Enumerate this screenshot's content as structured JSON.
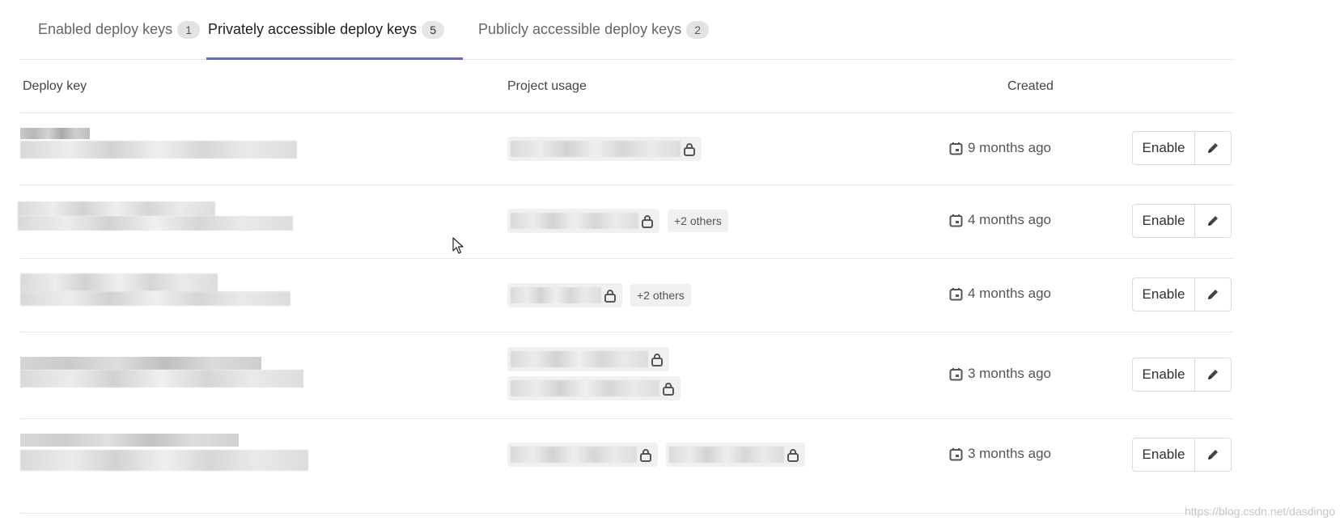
{
  "tabs": [
    {
      "label": "Enabled deploy keys",
      "count": "1"
    },
    {
      "label": "Privately accessible deploy keys",
      "count": "5"
    },
    {
      "label": "Publicly accessible deploy keys",
      "count": "2"
    }
  ],
  "table": {
    "headers": {
      "deploy_key": "Deploy key",
      "project_usage": "Project usage",
      "created": "Created"
    },
    "rows": [
      {
        "others": "",
        "created": "9 months ago",
        "enable_label": "Enable"
      },
      {
        "others": "+2 others",
        "created": "4 months ago",
        "enable_label": "Enable"
      },
      {
        "others": "+2 others",
        "created": "4 months ago",
        "enable_label": "Enable"
      },
      {
        "others": "",
        "created": "3 months ago",
        "enable_label": "Enable"
      },
      {
        "others": "",
        "created": "3 months ago",
        "enable_label": "Enable"
      }
    ]
  },
  "icons": {
    "lock": "lock-icon",
    "calendar": "calendar-icon",
    "edit": "pencil-icon"
  },
  "watermark": "https://blog.csdn.net/dasdingo",
  "colors": {
    "active_tab_underline": "#6666c4"
  }
}
